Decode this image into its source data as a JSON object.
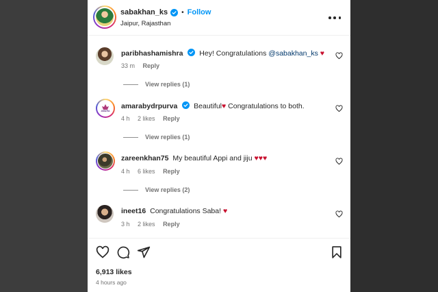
{
  "header": {
    "username": "sabakhan_ks",
    "separator": "•",
    "follow_label": "Follow",
    "location": "Jaipur, Rajasthan"
  },
  "comments": [
    {
      "username": "paribhashamishra",
      "verified": true,
      "text": "Hey! Congratulations ",
      "mention": "@sabakhan_ks",
      "emoji": " ♥",
      "time": "33 m",
      "likes": "",
      "reply_label": "Reply",
      "view_replies": "View replies (1)"
    },
    {
      "username": "amarabydrpurva",
      "verified": true,
      "text": "Beautiful",
      "emoji_mid": "♥",
      "text_after": " Congratulations to both.",
      "time": "4 h",
      "likes": "2 likes",
      "reply_label": "Reply",
      "view_replies": "View replies (1)",
      "avatar_text": "AMARA"
    },
    {
      "username": "zareenkhan75",
      "verified": false,
      "text": "My beautiful Appi and jiju ",
      "emoji": "♥♥♥",
      "time": "4 h",
      "likes": "6 likes",
      "reply_label": "Reply",
      "view_replies": "View replies (2)"
    },
    {
      "username": "ineet16",
      "verified": false,
      "text": "Congratulations Saba! ",
      "emoji": "♥",
      "time": "3 h",
      "likes": "2 likes",
      "reply_label": "Reply"
    }
  ],
  "actions": {
    "likes_count": "6,913 likes",
    "time_ago": "4 hours ago"
  },
  "icons": {
    "more": "more-options-icon",
    "verified": "verified-badge-icon",
    "like": "heart-outline-icon",
    "comment": "comment-bubble-icon",
    "share": "paper-plane-icon",
    "save": "bookmark-icon"
  },
  "colors": {
    "link_blue": "#0095f6",
    "verified_blue": "#0095f6",
    "heart_red": "#c8102e",
    "meta_gray": "#737373"
  }
}
